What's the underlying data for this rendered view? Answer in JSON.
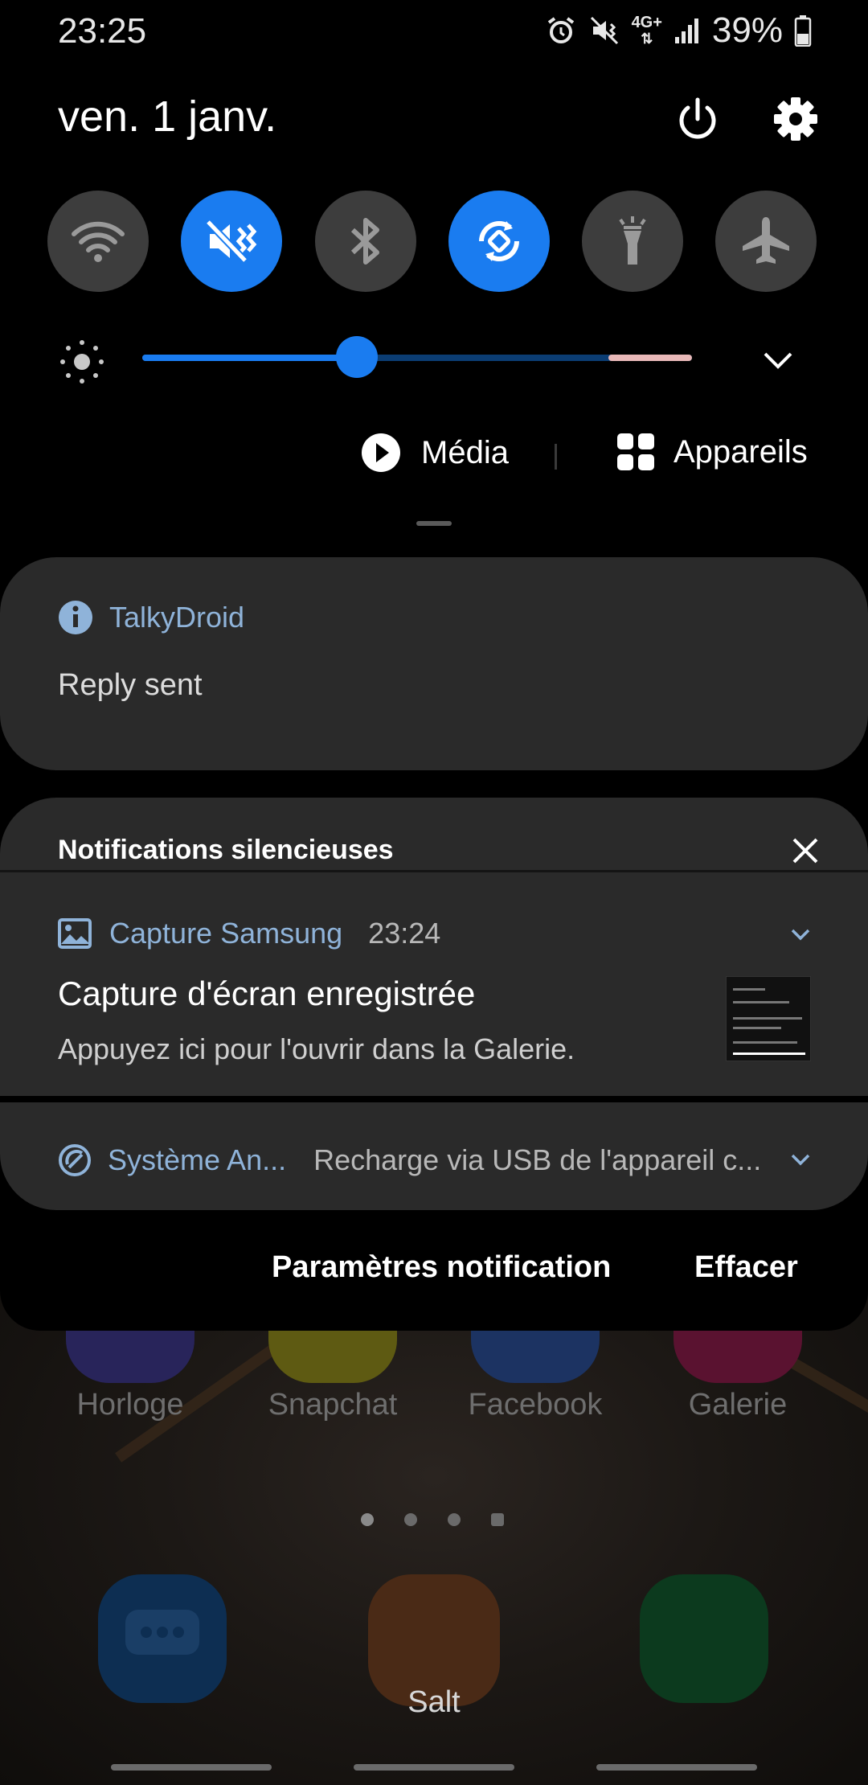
{
  "status_bar": {
    "time": "23:25",
    "battery": "39%",
    "network": "4G+"
  },
  "header": {
    "date": "ven. 1 janv."
  },
  "quick_toggles": [
    {
      "name": "wifi",
      "on": false
    },
    {
      "name": "mute",
      "on": true
    },
    {
      "name": "bluetooth",
      "on": false
    },
    {
      "name": "auto-rotate",
      "on": true
    },
    {
      "name": "flashlight",
      "on": false
    },
    {
      "name": "airplane",
      "on": false
    }
  ],
  "brightness": {
    "level": 0.39
  },
  "media": {
    "media_label": "Média",
    "devices_label": "Appareils"
  },
  "notifications": {
    "talky": {
      "app": "TalkyDroid",
      "message": "Reply sent"
    },
    "silent_section": {
      "title": "Notifications silencieuses",
      "capture": {
        "app": "Capture Samsung",
        "time": "23:24",
        "title": "Capture d'écran enregistrée",
        "body": "Appuyez ici pour l'ouvrir dans la Galerie."
      },
      "system": {
        "app": "Système An...",
        "text": "Recharge via USB de l'appareil c..."
      }
    },
    "footer": {
      "settings_label": "Paramètres notification",
      "clear_label": "Effacer"
    }
  },
  "home_screen": {
    "apps_row": [
      "Horloge",
      "Snapchat",
      "Facebook",
      "Galerie"
    ],
    "dock_label": "Salt"
  },
  "colors": {
    "accent": "#1a7cf0",
    "card": "#2a2a2a",
    "app_name": "#8fb3d9"
  }
}
